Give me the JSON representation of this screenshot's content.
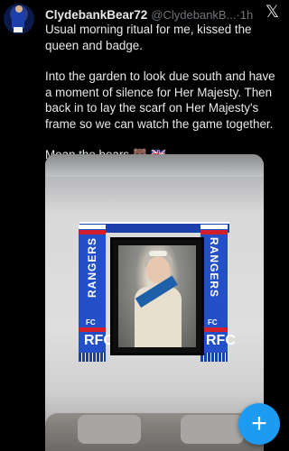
{
  "post": {
    "author_name": "ClydebankBear72",
    "author_handle": "@ClydebankB...",
    "separator": "·",
    "time": "1h",
    "paragraphs": [
      "Usual morning ritual for me, kissed the queen and badge.",
      "Into the garden to look due south and have a moment of silence for Her Majesty. Then back in to lay the scarf on Her Majesty's frame so we can watch the game together.",
      "Moan the bears 🐻 🇬🇧"
    ]
  },
  "media": {
    "scarf_text": "RANGERS",
    "scarf_fc": "FC",
    "scarf_crest": "RFC"
  },
  "controls": {
    "close_glyph": "𝕏",
    "compose_glyph": "+"
  },
  "colors": {
    "background": "#000000",
    "text": "#e7e9ea",
    "secondary_text": "#71767b",
    "accent": "#1d9bf0",
    "scarf_blue": "#2350c8",
    "scarf_red": "#d21f2b"
  }
}
